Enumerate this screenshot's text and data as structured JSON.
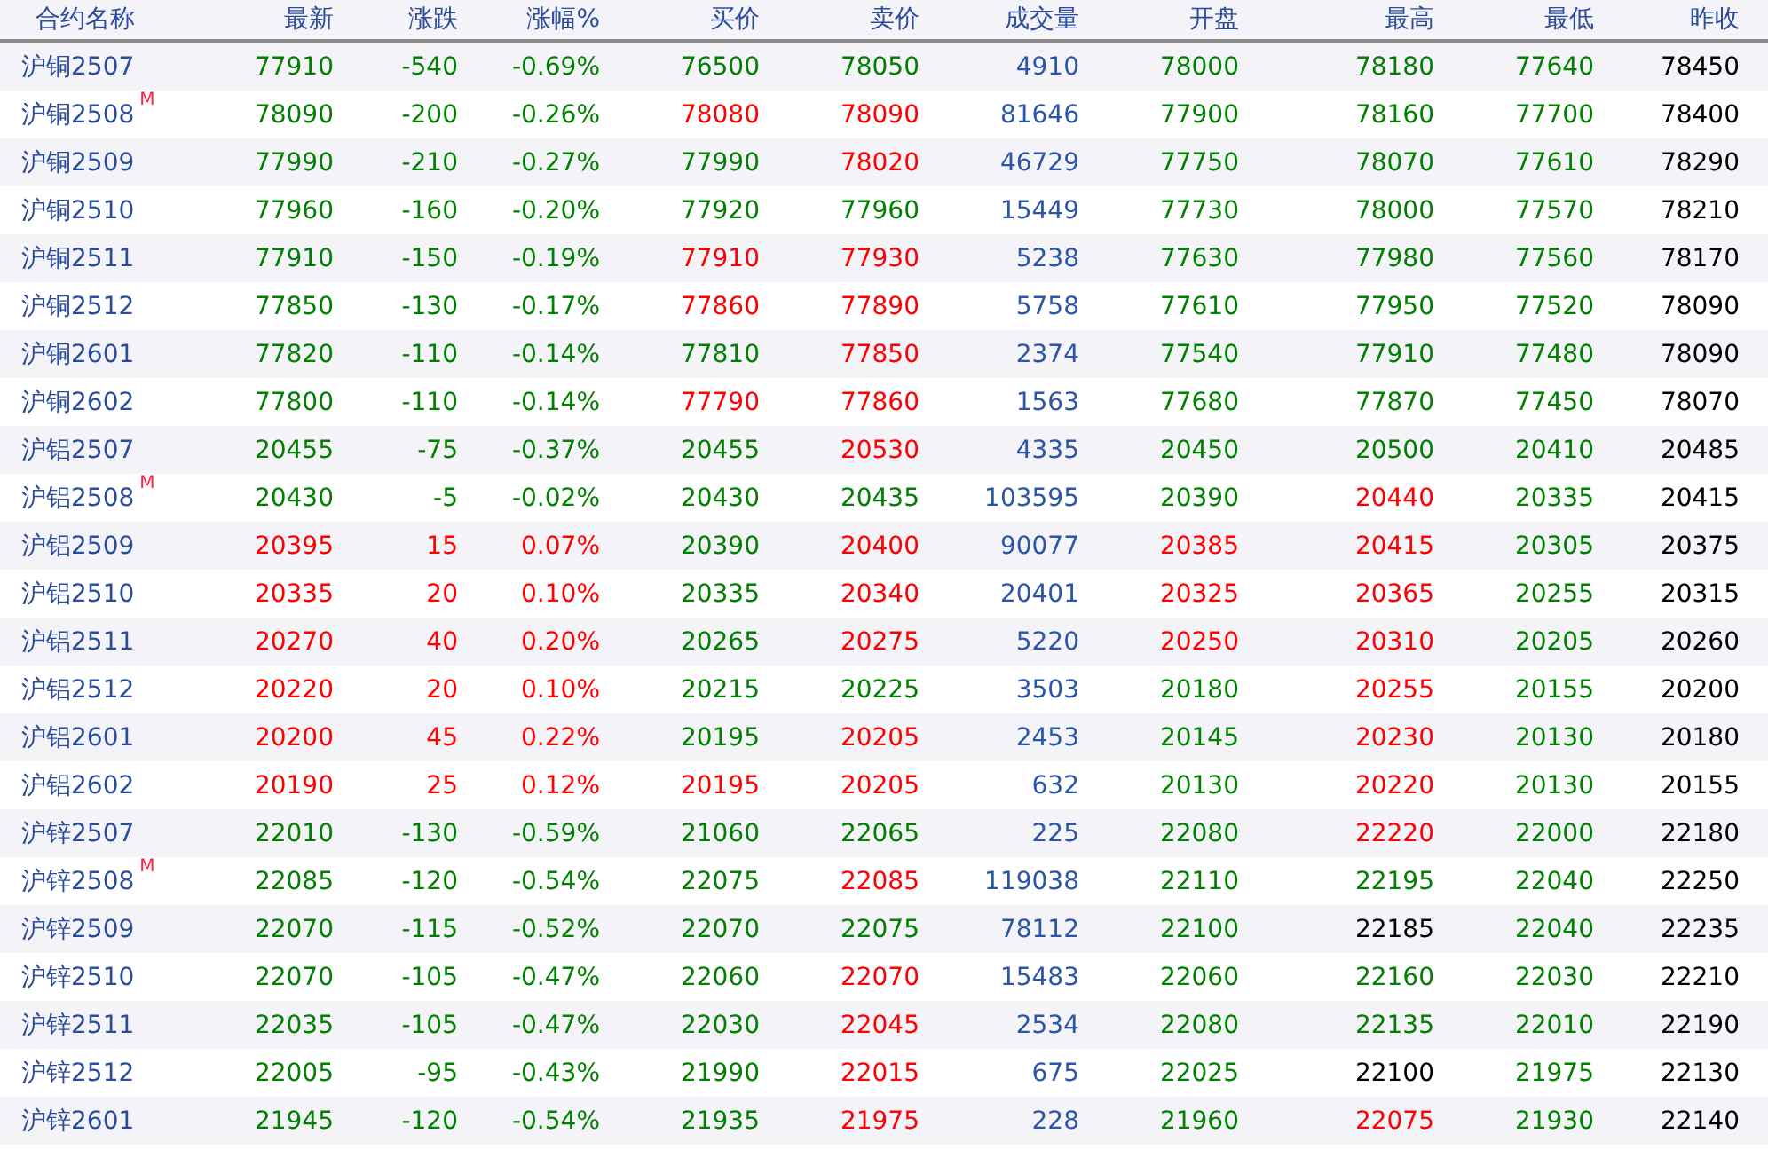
{
  "table": {
    "name_column": "合约名称",
    "columns": [
      "最新",
      "涨跌",
      "涨幅%",
      "买价",
      "卖价",
      "成交量",
      "开盘",
      "最高",
      "最低",
      "昨收"
    ],
    "rows": [
      {
        "name": "沪铜2507",
        "cells": [
          {
            "text": "77910",
            "color": "#008000"
          },
          {
            "text": "-540",
            "color": "#008000"
          },
          {
            "text": "-0.69%",
            "color": "#008000"
          },
          {
            "text": "76500",
            "color": "#008000"
          },
          {
            "text": "78050",
            "color": "#008000"
          },
          {
            "text": "4910",
            "color": "#2b55a8"
          },
          {
            "text": "78000",
            "color": "#008000"
          },
          {
            "text": "78180",
            "color": "#008000"
          },
          {
            "text": "77640",
            "color": "#008000"
          },
          {
            "text": "78450",
            "color": "#000000"
          }
        ]
      },
      {
        "name": "沪铜2508",
        "badge": "M",
        "cells": [
          {
            "text": "78090",
            "color": "#008000"
          },
          {
            "text": "-200",
            "color": "#008000"
          },
          {
            "text": "-0.26%",
            "color": "#008000"
          },
          {
            "text": "78080",
            "color": "#ff0000"
          },
          {
            "text": "78090",
            "color": "#ff0000"
          },
          {
            "text": "81646",
            "color": "#2b55a8"
          },
          {
            "text": "77900",
            "color": "#008000"
          },
          {
            "text": "78160",
            "color": "#008000"
          },
          {
            "text": "77700",
            "color": "#008000"
          },
          {
            "text": "78400",
            "color": "#000000"
          }
        ]
      },
      {
        "name": "沪铜2509",
        "cells": [
          {
            "text": "77990",
            "color": "#008000"
          },
          {
            "text": "-210",
            "color": "#008000"
          },
          {
            "text": "-0.27%",
            "color": "#008000"
          },
          {
            "text": "77990",
            "color": "#008000"
          },
          {
            "text": "78020",
            "color": "#ff0000"
          },
          {
            "text": "46729",
            "color": "#2b55a8"
          },
          {
            "text": "77750",
            "color": "#008000"
          },
          {
            "text": "78070",
            "color": "#008000"
          },
          {
            "text": "77610",
            "color": "#008000"
          },
          {
            "text": "78290",
            "color": "#000000"
          }
        ]
      },
      {
        "name": "沪铜2510",
        "cells": [
          {
            "text": "77960",
            "color": "#008000"
          },
          {
            "text": "-160",
            "color": "#008000"
          },
          {
            "text": "-0.20%",
            "color": "#008000"
          },
          {
            "text": "77920",
            "color": "#008000"
          },
          {
            "text": "77960",
            "color": "#008000"
          },
          {
            "text": "15449",
            "color": "#2b55a8"
          },
          {
            "text": "77730",
            "color": "#008000"
          },
          {
            "text": "78000",
            "color": "#008000"
          },
          {
            "text": "77570",
            "color": "#008000"
          },
          {
            "text": "78210",
            "color": "#000000"
          }
        ]
      },
      {
        "name": "沪铜2511",
        "cells": [
          {
            "text": "77910",
            "color": "#008000"
          },
          {
            "text": "-150",
            "color": "#008000"
          },
          {
            "text": "-0.19%",
            "color": "#008000"
          },
          {
            "text": "77910",
            "color": "#ff0000"
          },
          {
            "text": "77930",
            "color": "#ff0000"
          },
          {
            "text": "5238",
            "color": "#2b55a8"
          },
          {
            "text": "77630",
            "color": "#008000"
          },
          {
            "text": "77980",
            "color": "#008000"
          },
          {
            "text": "77560",
            "color": "#008000"
          },
          {
            "text": "78170",
            "color": "#000000"
          }
        ]
      },
      {
        "name": "沪铜2512",
        "cells": [
          {
            "text": "77850",
            "color": "#008000"
          },
          {
            "text": "-130",
            "color": "#008000"
          },
          {
            "text": "-0.17%",
            "color": "#008000"
          },
          {
            "text": "77860",
            "color": "#ff0000"
          },
          {
            "text": "77890",
            "color": "#ff0000"
          },
          {
            "text": "5758",
            "color": "#2b55a8"
          },
          {
            "text": "77610",
            "color": "#008000"
          },
          {
            "text": "77950",
            "color": "#008000"
          },
          {
            "text": "77520",
            "color": "#008000"
          },
          {
            "text": "78090",
            "color": "#000000"
          }
        ]
      },
      {
        "name": "沪铜2601",
        "cells": [
          {
            "text": "77820",
            "color": "#008000"
          },
          {
            "text": "-110",
            "color": "#008000"
          },
          {
            "text": "-0.14%",
            "color": "#008000"
          },
          {
            "text": "77810",
            "color": "#008000"
          },
          {
            "text": "77850",
            "color": "#ff0000"
          },
          {
            "text": "2374",
            "color": "#2b55a8"
          },
          {
            "text": "77540",
            "color": "#008000"
          },
          {
            "text": "77910",
            "color": "#008000"
          },
          {
            "text": "77480",
            "color": "#008000"
          },
          {
            "text": "78090",
            "color": "#000000"
          }
        ]
      },
      {
        "name": "沪铜2602",
        "cells": [
          {
            "text": "77800",
            "color": "#008000"
          },
          {
            "text": "-110",
            "color": "#008000"
          },
          {
            "text": "-0.14%",
            "color": "#008000"
          },
          {
            "text": "77790",
            "color": "#ff0000"
          },
          {
            "text": "77860",
            "color": "#ff0000"
          },
          {
            "text": "1563",
            "color": "#2b55a8"
          },
          {
            "text": "77680",
            "color": "#008000"
          },
          {
            "text": "77870",
            "color": "#008000"
          },
          {
            "text": "77450",
            "color": "#008000"
          },
          {
            "text": "78070",
            "color": "#000000"
          }
        ]
      },
      {
        "name": "沪铝2507",
        "cells": [
          {
            "text": "20455",
            "color": "#008000"
          },
          {
            "text": "-75",
            "color": "#008000"
          },
          {
            "text": "-0.37%",
            "color": "#008000"
          },
          {
            "text": "20455",
            "color": "#008000"
          },
          {
            "text": "20530",
            "color": "#ff0000"
          },
          {
            "text": "4335",
            "color": "#2b55a8"
          },
          {
            "text": "20450",
            "color": "#008000"
          },
          {
            "text": "20500",
            "color": "#008000"
          },
          {
            "text": "20410",
            "color": "#008000"
          },
          {
            "text": "20485",
            "color": "#000000"
          }
        ]
      },
      {
        "name": "沪铝2508",
        "badge": "M",
        "cells": [
          {
            "text": "20430",
            "color": "#008000"
          },
          {
            "text": "-5",
            "color": "#008000"
          },
          {
            "text": "-0.02%",
            "color": "#008000"
          },
          {
            "text": "20430",
            "color": "#008000"
          },
          {
            "text": "20435",
            "color": "#008000"
          },
          {
            "text": "103595",
            "color": "#2b55a8"
          },
          {
            "text": "20390",
            "color": "#008000"
          },
          {
            "text": "20440",
            "color": "#ff0000"
          },
          {
            "text": "20335",
            "color": "#008000"
          },
          {
            "text": "20415",
            "color": "#000000"
          }
        ]
      },
      {
        "name": "沪铝2509",
        "cells": [
          {
            "text": "20395",
            "color": "#ff0000"
          },
          {
            "text": "15",
            "color": "#ff0000"
          },
          {
            "text": "0.07%",
            "color": "#ff0000"
          },
          {
            "text": "20390",
            "color": "#008000"
          },
          {
            "text": "20400",
            "color": "#ff0000"
          },
          {
            "text": "90077",
            "color": "#2b55a8"
          },
          {
            "text": "20385",
            "color": "#ff0000"
          },
          {
            "text": "20415",
            "color": "#ff0000"
          },
          {
            "text": "20305",
            "color": "#008000"
          },
          {
            "text": "20375",
            "color": "#000000"
          }
        ]
      },
      {
        "name": "沪铝2510",
        "cells": [
          {
            "text": "20335",
            "color": "#ff0000"
          },
          {
            "text": "20",
            "color": "#ff0000"
          },
          {
            "text": "0.10%",
            "color": "#ff0000"
          },
          {
            "text": "20335",
            "color": "#008000"
          },
          {
            "text": "20340",
            "color": "#ff0000"
          },
          {
            "text": "20401",
            "color": "#2b55a8"
          },
          {
            "text": "20325",
            "color": "#ff0000"
          },
          {
            "text": "20365",
            "color": "#ff0000"
          },
          {
            "text": "20255",
            "color": "#008000"
          },
          {
            "text": "20315",
            "color": "#000000"
          }
        ]
      },
      {
        "name": "沪铝2511",
        "cells": [
          {
            "text": "20270",
            "color": "#ff0000"
          },
          {
            "text": "40",
            "color": "#ff0000"
          },
          {
            "text": "0.20%",
            "color": "#ff0000"
          },
          {
            "text": "20265",
            "color": "#008000"
          },
          {
            "text": "20275",
            "color": "#ff0000"
          },
          {
            "text": "5220",
            "color": "#2b55a8"
          },
          {
            "text": "20250",
            "color": "#ff0000"
          },
          {
            "text": "20310",
            "color": "#ff0000"
          },
          {
            "text": "20205",
            "color": "#008000"
          },
          {
            "text": "20260",
            "color": "#000000"
          }
        ]
      },
      {
        "name": "沪铝2512",
        "cells": [
          {
            "text": "20220",
            "color": "#ff0000"
          },
          {
            "text": "20",
            "color": "#ff0000"
          },
          {
            "text": "0.10%",
            "color": "#ff0000"
          },
          {
            "text": "20215",
            "color": "#008000"
          },
          {
            "text": "20225",
            "color": "#008000"
          },
          {
            "text": "3503",
            "color": "#2b55a8"
          },
          {
            "text": "20180",
            "color": "#008000"
          },
          {
            "text": "20255",
            "color": "#ff0000"
          },
          {
            "text": "20155",
            "color": "#008000"
          },
          {
            "text": "20200",
            "color": "#000000"
          }
        ]
      },
      {
        "name": "沪铝2601",
        "cells": [
          {
            "text": "20200",
            "color": "#ff0000"
          },
          {
            "text": "45",
            "color": "#ff0000"
          },
          {
            "text": "0.22%",
            "color": "#ff0000"
          },
          {
            "text": "20195",
            "color": "#008000"
          },
          {
            "text": "20205",
            "color": "#ff0000"
          },
          {
            "text": "2453",
            "color": "#2b55a8"
          },
          {
            "text": "20145",
            "color": "#008000"
          },
          {
            "text": "20230",
            "color": "#ff0000"
          },
          {
            "text": "20130",
            "color": "#008000"
          },
          {
            "text": "20180",
            "color": "#000000"
          }
        ]
      },
      {
        "name": "沪铝2602",
        "cells": [
          {
            "text": "20190",
            "color": "#ff0000"
          },
          {
            "text": "25",
            "color": "#ff0000"
          },
          {
            "text": "0.12%",
            "color": "#ff0000"
          },
          {
            "text": "20195",
            "color": "#ff0000"
          },
          {
            "text": "20205",
            "color": "#ff0000"
          },
          {
            "text": "632",
            "color": "#2b55a8"
          },
          {
            "text": "20130",
            "color": "#008000"
          },
          {
            "text": "20220",
            "color": "#ff0000"
          },
          {
            "text": "20130",
            "color": "#008000"
          },
          {
            "text": "20155",
            "color": "#000000"
          }
        ]
      },
      {
        "name": "沪锌2507",
        "cells": [
          {
            "text": "22010",
            "color": "#008000"
          },
          {
            "text": "-130",
            "color": "#008000"
          },
          {
            "text": "-0.59%",
            "color": "#008000"
          },
          {
            "text": "21060",
            "color": "#008000"
          },
          {
            "text": "22065",
            "color": "#008000"
          },
          {
            "text": "225",
            "color": "#2b55a8"
          },
          {
            "text": "22080",
            "color": "#008000"
          },
          {
            "text": "22220",
            "color": "#ff0000"
          },
          {
            "text": "22000",
            "color": "#008000"
          },
          {
            "text": "22180",
            "color": "#000000"
          }
        ]
      },
      {
        "name": "沪锌2508",
        "badge": "M",
        "cells": [
          {
            "text": "22085",
            "color": "#008000"
          },
          {
            "text": "-120",
            "color": "#008000"
          },
          {
            "text": "-0.54%",
            "color": "#008000"
          },
          {
            "text": "22075",
            "color": "#008000"
          },
          {
            "text": "22085",
            "color": "#ff0000"
          },
          {
            "text": "119038",
            "color": "#2b55a8"
          },
          {
            "text": "22110",
            "color": "#008000"
          },
          {
            "text": "22195",
            "color": "#008000"
          },
          {
            "text": "22040",
            "color": "#008000"
          },
          {
            "text": "22250",
            "color": "#000000"
          }
        ]
      },
      {
        "name": "沪锌2509",
        "cells": [
          {
            "text": "22070",
            "color": "#008000"
          },
          {
            "text": "-115",
            "color": "#008000"
          },
          {
            "text": "-0.52%",
            "color": "#008000"
          },
          {
            "text": "22070",
            "color": "#008000"
          },
          {
            "text": "22075",
            "color": "#008000"
          },
          {
            "text": "78112",
            "color": "#2b55a8"
          },
          {
            "text": "22100",
            "color": "#008000"
          },
          {
            "text": "22185",
            "color": "#000000"
          },
          {
            "text": "22040",
            "color": "#008000"
          },
          {
            "text": "22235",
            "color": "#000000"
          }
        ]
      },
      {
        "name": "沪锌2510",
        "cells": [
          {
            "text": "22070",
            "color": "#008000"
          },
          {
            "text": "-105",
            "color": "#008000"
          },
          {
            "text": "-0.47%",
            "color": "#008000"
          },
          {
            "text": "22060",
            "color": "#008000"
          },
          {
            "text": "22070",
            "color": "#ff0000"
          },
          {
            "text": "15483",
            "color": "#2b55a8"
          },
          {
            "text": "22060",
            "color": "#008000"
          },
          {
            "text": "22160",
            "color": "#008000"
          },
          {
            "text": "22030",
            "color": "#008000"
          },
          {
            "text": "22210",
            "color": "#000000"
          }
        ]
      },
      {
        "name": "沪锌2511",
        "cells": [
          {
            "text": "22035",
            "color": "#008000"
          },
          {
            "text": "-105",
            "color": "#008000"
          },
          {
            "text": "-0.47%",
            "color": "#008000"
          },
          {
            "text": "22030",
            "color": "#008000"
          },
          {
            "text": "22045",
            "color": "#ff0000"
          },
          {
            "text": "2534",
            "color": "#2b55a8"
          },
          {
            "text": "22080",
            "color": "#008000"
          },
          {
            "text": "22135",
            "color": "#008000"
          },
          {
            "text": "22010",
            "color": "#008000"
          },
          {
            "text": "22190",
            "color": "#000000"
          }
        ]
      },
      {
        "name": "沪锌2512",
        "cells": [
          {
            "text": "22005",
            "color": "#008000"
          },
          {
            "text": "-95",
            "color": "#008000"
          },
          {
            "text": "-0.43%",
            "color": "#008000"
          },
          {
            "text": "21990",
            "color": "#008000"
          },
          {
            "text": "22015",
            "color": "#ff0000"
          },
          {
            "text": "675",
            "color": "#2b55a8"
          },
          {
            "text": "22025",
            "color": "#008000"
          },
          {
            "text": "22100",
            "color": "#000000"
          },
          {
            "text": "21975",
            "color": "#008000"
          },
          {
            "text": "22130",
            "color": "#000000"
          }
        ]
      },
      {
        "name": "沪锌2601",
        "cells": [
          {
            "text": "21945",
            "color": "#008000"
          },
          {
            "text": "-120",
            "color": "#008000"
          },
          {
            "text": "-0.54%",
            "color": "#008000"
          },
          {
            "text": "21935",
            "color": "#008000"
          },
          {
            "text": "21975",
            "color": "#ff0000"
          },
          {
            "text": "228",
            "color": "#2b55a8"
          },
          {
            "text": "21960",
            "color": "#008000"
          },
          {
            "text": "22075",
            "color": "#ff0000"
          },
          {
            "text": "21930",
            "color": "#008000"
          },
          {
            "text": "22140",
            "color": "#000000"
          }
        ]
      }
    ]
  }
}
